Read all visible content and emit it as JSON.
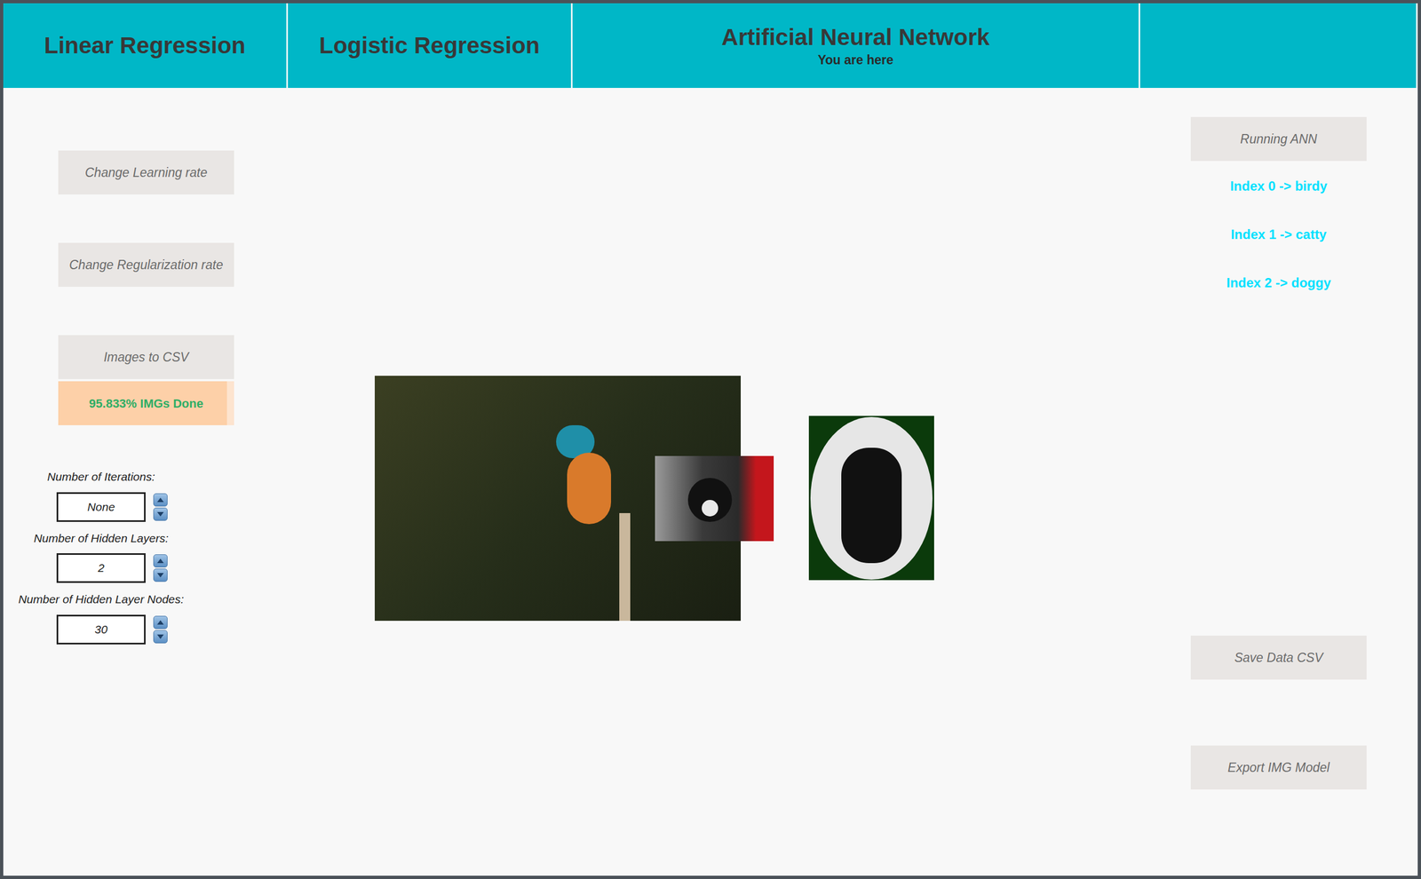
{
  "tabs": [
    {
      "label": "Linear Regression",
      "selected": false,
      "subtitle": ""
    },
    {
      "label": "Logistic Regression",
      "selected": false,
      "subtitle": ""
    },
    {
      "label": "Artificial Neural Network",
      "selected": true,
      "subtitle": "You are here"
    },
    {
      "label": "",
      "selected": false,
      "subtitle": ""
    }
  ],
  "left_buttons": [
    "Change Learning rate",
    "Change Regularization rate",
    "Images to CSV"
  ],
  "progress": {
    "text": "95.833% IMGs Done",
    "level": 0.95833
  },
  "number_fields": [
    {
      "label": "Number of Iterations:",
      "value": "None"
    },
    {
      "label": "Number of Hidden Layers:",
      "value": "2"
    },
    {
      "label": "Number of Hidden Layer Nodes:",
      "value": "30"
    }
  ],
  "run_button": "Running ANN",
  "class_indices": [
    "Index 0 -> birdy",
    "Index 1 -> catty",
    "Index 2 -> doggy"
  ],
  "action_buttons": [
    "Save Data CSV",
    "Export IMG Model"
  ]
}
